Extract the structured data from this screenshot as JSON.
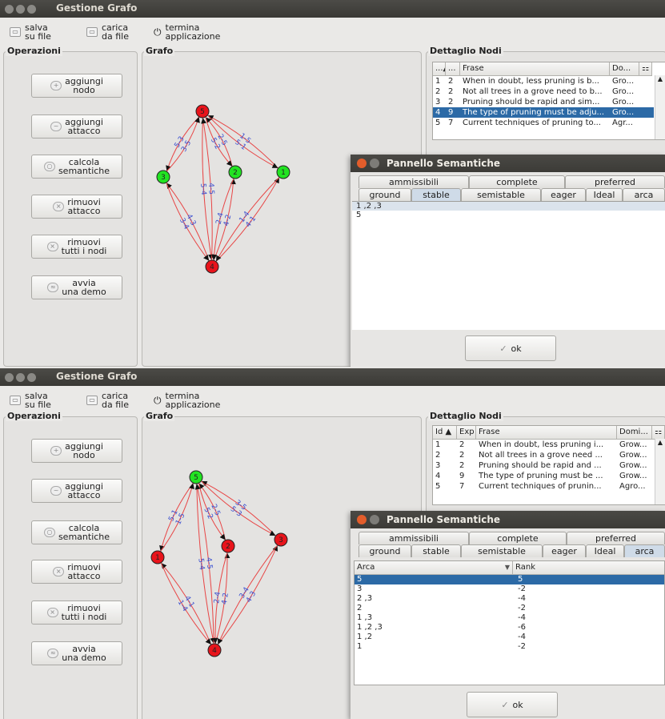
{
  "top": {
    "window_title": "Gestione Grafo",
    "toolbar": [
      {
        "label": "salva\nsu file",
        "icon": "save-icon"
      },
      {
        "label": "carica\nda file",
        "icon": "load-icon"
      },
      {
        "label": "termina\napplicazione",
        "icon": "power-icon"
      }
    ],
    "operations_title": "Operazioni",
    "operations": [
      {
        "label": "aggiungi\nnodo",
        "icon": "add-node-icon"
      },
      {
        "label": "aggiungi\nattacco",
        "icon": "add-attack-icon"
      },
      {
        "label": "calcola\nsemantiche",
        "icon": "compute-icon"
      },
      {
        "label": "rimuovi\nattacco",
        "icon": "remove-attack-icon"
      },
      {
        "label": "rimuovi\ntutti i nodi",
        "icon": "remove-all-icon"
      },
      {
        "label": "avvia\nuna demo",
        "icon": "demo-icon"
      }
    ],
    "graph_title": "Grafo",
    "graph": {
      "nodes": [
        {
          "id": "5",
          "color": "#e8141b"
        },
        {
          "id": "3",
          "color": "#22e322"
        },
        {
          "id": "2",
          "color": "#22e322"
        },
        {
          "id": "1",
          "color": "#22e322"
        },
        {
          "id": "4",
          "color": "#e8141b"
        }
      ],
      "edges": [
        "5,3",
        "3,5",
        "2,5",
        "5,2",
        "1,5",
        "5,1",
        "4,3",
        "3,4",
        "5,4",
        "4,5",
        "4,2",
        "2,4",
        "4,1",
        "1,4"
      ]
    },
    "details_title": "Dettaglio Nodi",
    "details_headers": [
      "...▲",
      "...",
      "Frase",
      "Do..."
    ],
    "details_rows": [
      {
        "id": "1",
        "exp": "2",
        "frase": "When in doubt, less pruning is b...",
        "dom": "Gro..."
      },
      {
        "id": "2",
        "exp": "2",
        "frase": "Not all trees in a grove need to b...",
        "dom": "Gro..."
      },
      {
        "id": "3",
        "exp": "2",
        "frase": "Pruning should be rapid and sim...",
        "dom": "Gro..."
      },
      {
        "id": "4",
        "exp": "9",
        "frase": "The type of pruning must be adju...",
        "dom": "Gro..."
      },
      {
        "id": "5",
        "exp": "7",
        "frase": "Current techniques of pruning to...",
        "dom": "Agr..."
      }
    ],
    "dialog": {
      "title": "Pannello Semantiche",
      "tabs_row1": [
        "ammissibili",
        "complete",
        "preferred"
      ],
      "tabs_row2": [
        "ground",
        "stable",
        "semistable",
        "eager",
        "Ideal",
        "arca"
      ],
      "active_tab": "stable",
      "results": [
        "1 ,2 ,3",
        "5"
      ],
      "ok": "ok"
    }
  },
  "bottom": {
    "window_title": "Gestione Grafo",
    "toolbar": [
      {
        "label": "salva\nsu file",
        "icon": "save-icon"
      },
      {
        "label": "carica\nda file",
        "icon": "load-icon"
      },
      {
        "label": "termina\napplicazione",
        "icon": "power-icon"
      }
    ],
    "operations_title": "Operazioni",
    "operations": [
      {
        "label": "aggiungi\nnodo",
        "icon": "add-node-icon"
      },
      {
        "label": "aggiungi\nattacco",
        "icon": "add-attack-icon"
      },
      {
        "label": "calcola\nsemantiche",
        "icon": "compute-icon"
      },
      {
        "label": "rimuovi\nattacco",
        "icon": "remove-attack-icon"
      },
      {
        "label": "rimuovi\ntutti i nodi",
        "icon": "remove-all-icon"
      },
      {
        "label": "avvia\nuna demo",
        "icon": "demo-icon"
      }
    ],
    "graph_title": "Grafo",
    "graph": {
      "nodes": [
        {
          "id": "5",
          "color": "#22e322"
        },
        {
          "id": "1",
          "color": "#e8141b"
        },
        {
          "id": "2",
          "color": "#e8141b"
        },
        {
          "id": "3",
          "color": "#e8141b"
        },
        {
          "id": "4",
          "color": "#e8141b"
        }
      ],
      "edges": [
        "5,1",
        "1,5",
        "2,5",
        "5,2",
        "3,5",
        "5,3",
        "4,1",
        "1,4",
        "5,4",
        "4,5",
        "4,2",
        "2,4",
        "4,3",
        "3,4"
      ]
    },
    "details_title": "Dettaglio Nodi",
    "details_headers": [
      "Id ▲",
      "Exp",
      "Frase",
      "Domi..."
    ],
    "details_rows": [
      {
        "id": "1",
        "exp": "2",
        "frase": "When in doubt, less pruning i...",
        "dom": "Grow..."
      },
      {
        "id": "2",
        "exp": "2",
        "frase": "Not all trees in a grove need ...",
        "dom": "Grow..."
      },
      {
        "id": "3",
        "exp": "2",
        "frase": "Pruning should be rapid and ...",
        "dom": "Grow..."
      },
      {
        "id": "4",
        "exp": "9",
        "frase": "The type of pruning must be ...",
        "dom": "Grow..."
      },
      {
        "id": "5",
        "exp": "7",
        "frase": "Current techniques of prunin...",
        "dom": "Agro..."
      }
    ],
    "dialog": {
      "title": "Pannello Semantiche",
      "tabs_row1": [
        "ammissibili",
        "complete",
        "preferred"
      ],
      "tabs_row2": [
        "ground",
        "stable",
        "semistable",
        "eager",
        "Ideal",
        "arca"
      ],
      "active_tab": "arca",
      "table_headers": [
        "Arca",
        "Rank"
      ],
      "table_rows": [
        {
          "arca": "5",
          "rank": "5"
        },
        {
          "arca": "3",
          "rank": "-2"
        },
        {
          "arca": "2 ,3",
          "rank": "-4"
        },
        {
          "arca": "2",
          "rank": "-2"
        },
        {
          "arca": "1 ,3",
          "rank": "-4"
        },
        {
          "arca": "1 ,2 ,3",
          "rank": "-6"
        },
        {
          "arca": "1 ,2",
          "rank": "-4"
        },
        {
          "arca": "1",
          "rank": "-2"
        }
      ],
      "ok": "ok"
    }
  }
}
